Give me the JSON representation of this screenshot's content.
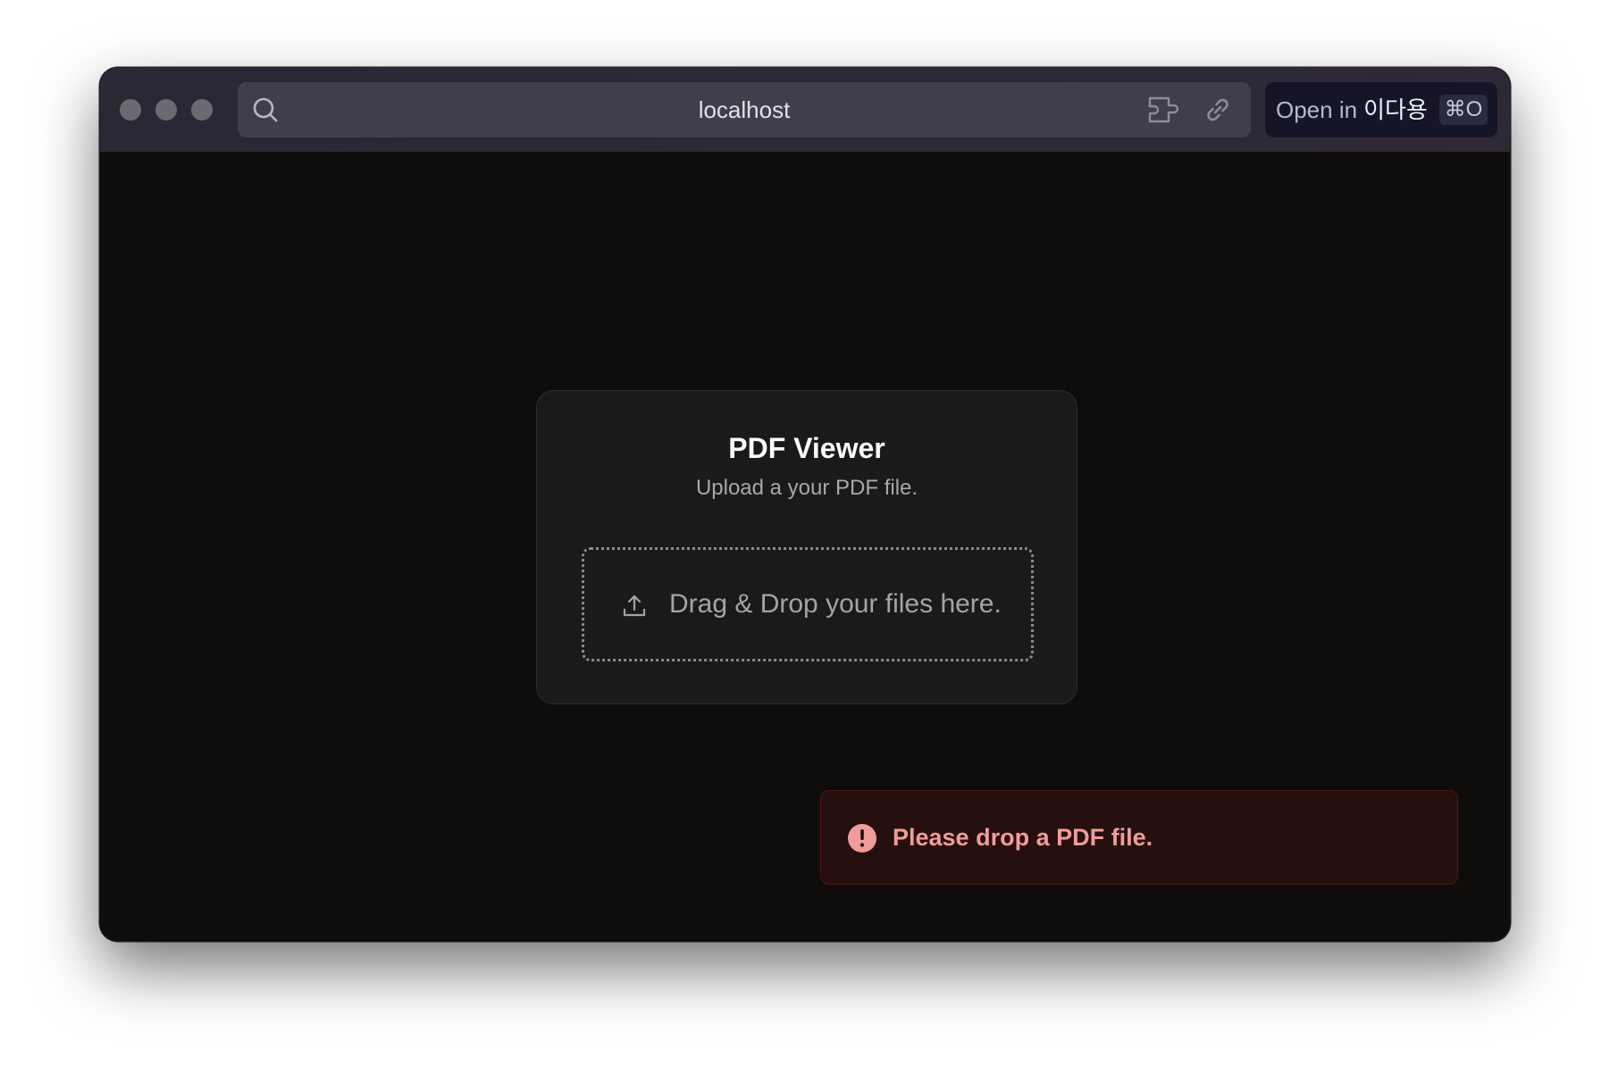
{
  "browser": {
    "url": "localhost",
    "open_in": {
      "label": "Open in",
      "app_name": "이다용",
      "shortcut": "⌘O"
    },
    "icons": [
      "search-icon",
      "extension-icon",
      "link-icon"
    ]
  },
  "app": {
    "title": "PDF Viewer",
    "subtitle": "Upload a your PDF file.",
    "dropzone": {
      "label": "Drag & Drop your files here.",
      "icon": "upload-icon"
    }
  },
  "toast": {
    "message": "Please drop a PDF file.",
    "icon": "alert-circle-icon",
    "color": "#f19b9b"
  },
  "colors": {
    "page_background": "#0e0d0c",
    "card_background": "#1b1a19",
    "toast_background": "#250f0f"
  }
}
